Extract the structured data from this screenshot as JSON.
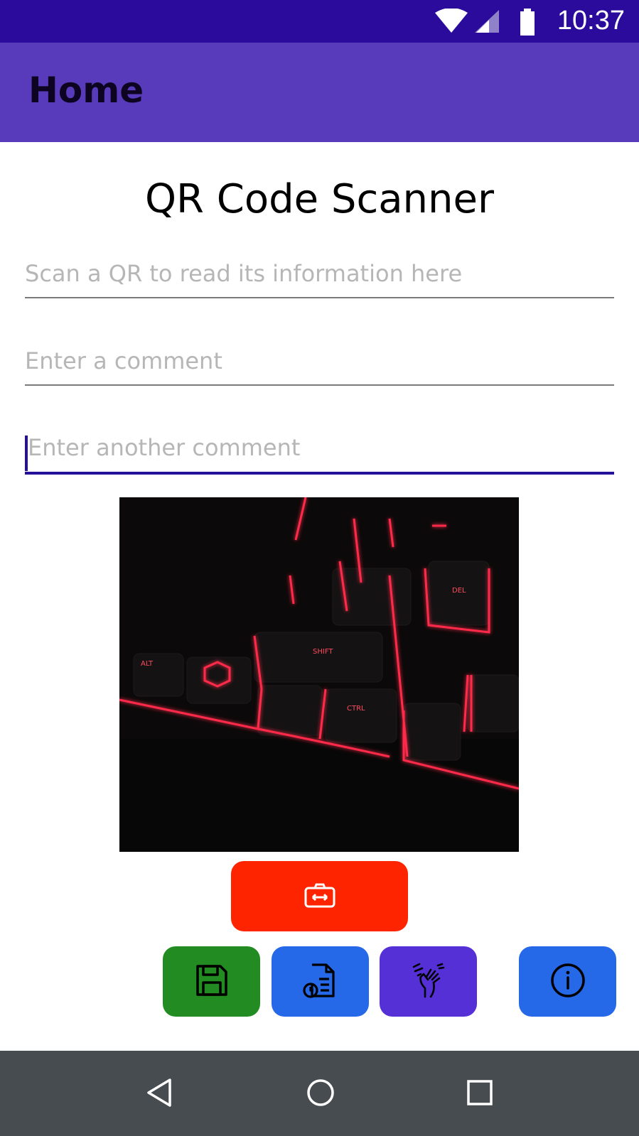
{
  "status_bar": {
    "time": "10:37",
    "icons": [
      "wifi-icon",
      "cellular-signal-icon",
      "battery-icon"
    ]
  },
  "app_bar": {
    "title": "Home",
    "color": "#583bbb"
  },
  "main": {
    "title": "QR Code Scanner",
    "fields": [
      {
        "name": "qr-result-field",
        "value": "",
        "placeholder": "Scan a QR to read its information here",
        "focused": false
      },
      {
        "name": "comment-field",
        "value": "",
        "placeholder": "Enter a comment",
        "focused": false
      },
      {
        "name": "another-comment-field",
        "value": "",
        "placeholder": "Enter another comment",
        "focused": true
      }
    ],
    "preview_image": "camera-preview-keyboard-photo",
    "buttons": [
      {
        "name": "switch-camera-button",
        "icon": "switch-camera-icon",
        "color": "#ff2400"
      },
      {
        "name": "save-button",
        "icon": "floppy-disk-icon",
        "color": "#228b22"
      },
      {
        "name": "history-button",
        "icon": "document-history-icon",
        "color": "#2568e8"
      },
      {
        "name": "clear-button",
        "icon": "hand-wipe-icon",
        "color": "#5530d6"
      },
      {
        "name": "info-button",
        "icon": "info-icon",
        "color": "#2568e8"
      }
    ]
  },
  "nav_bar": {
    "icons": [
      "back-icon",
      "home-icon",
      "recents-icon"
    ]
  }
}
